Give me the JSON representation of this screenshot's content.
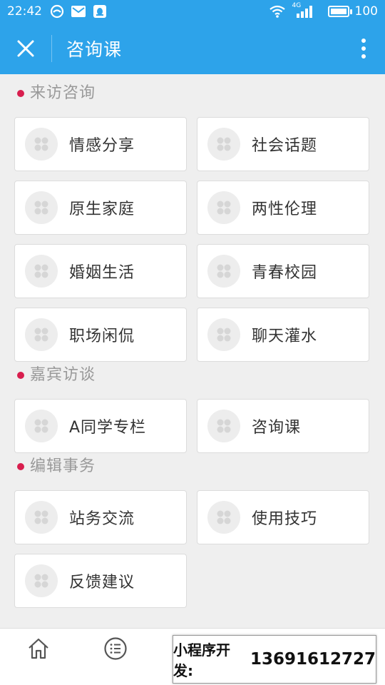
{
  "status_bar": {
    "time": "22:42",
    "battery": "100",
    "signal_label": "4G",
    "icons": [
      "browser-icon",
      "mail-icon",
      "qq-icon",
      "wifi-icon",
      "signal-icon",
      "battery-icon"
    ]
  },
  "app_bar": {
    "title": "咨询课",
    "icons": [
      "close-icon",
      "more-vertical-icon"
    ]
  },
  "sections": [
    {
      "title": "来访咨询",
      "items": [
        {
          "label": "情感分享"
        },
        {
          "label": "社会话题"
        },
        {
          "label": "原生家庭"
        },
        {
          "label": "两性伦理"
        },
        {
          "label": "婚姻生活"
        },
        {
          "label": "青春校园"
        },
        {
          "label": "职场闲侃"
        },
        {
          "label": "聊天灌水"
        }
      ]
    },
    {
      "title": "嘉宾访谈",
      "items": [
        {
          "label": "A同学专栏"
        },
        {
          "label": "咨询课"
        }
      ]
    },
    {
      "title": "编辑事务",
      "items": [
        {
          "label": "站务交流"
        },
        {
          "label": "使用技巧"
        },
        {
          "label": "反馈建议"
        }
      ]
    }
  ],
  "tab_bar": {
    "icons": [
      "home-icon",
      "list-icon"
    ]
  },
  "watermark": {
    "label": "小程序开发:",
    "phone": "13691612727"
  },
  "colors": {
    "primary": "#2da3ea",
    "section_dot": "#d81e4e",
    "background": "#efefef"
  }
}
